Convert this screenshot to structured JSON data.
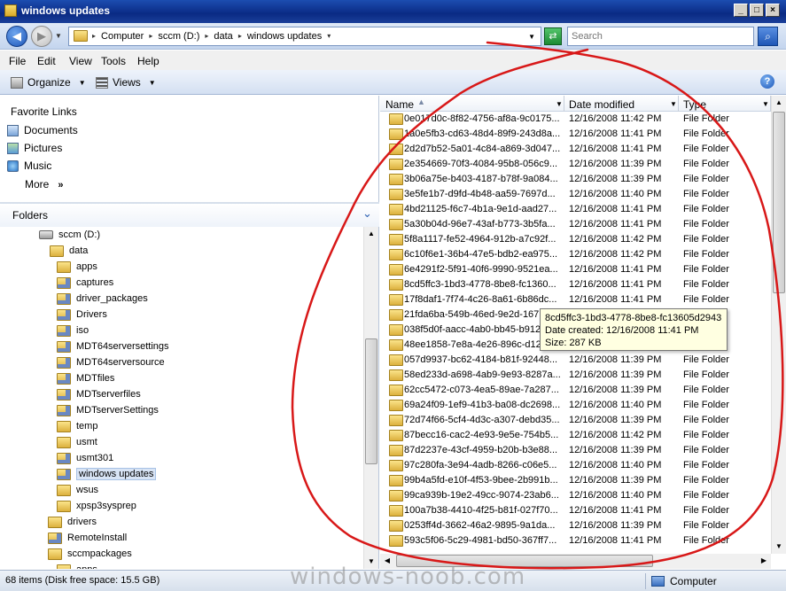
{
  "window": {
    "title": "windows updates"
  },
  "address": {
    "crumbs": [
      "Computer",
      "sccm (D:)",
      "data",
      "windows updates"
    ],
    "search_placeholder": "Search"
  },
  "menu": [
    "File",
    "Edit",
    "View",
    "Tools",
    "Help"
  ],
  "toolbar": {
    "organize": "Organize",
    "views": "Views"
  },
  "favorites": {
    "header": "Favorite Links",
    "items": [
      "Documents",
      "Pictures",
      "Music"
    ],
    "more": "More"
  },
  "folders": {
    "header": "Folders",
    "tree": [
      {
        "label": "sccm (D:)",
        "kind": "drive"
      },
      {
        "label": "data",
        "kind": "folder"
      },
      {
        "label": "apps",
        "kind": "folder"
      },
      {
        "label": "captures",
        "kind": "net"
      },
      {
        "label": "driver_packages",
        "kind": "net"
      },
      {
        "label": "Drivers",
        "kind": "net"
      },
      {
        "label": "iso",
        "kind": "net"
      },
      {
        "label": "MDT64serversettings",
        "kind": "net"
      },
      {
        "label": "MDT64serversource",
        "kind": "net"
      },
      {
        "label": "MDTfiles",
        "kind": "net"
      },
      {
        "label": "MDTserverfiles",
        "kind": "net"
      },
      {
        "label": "MDTserverSettings",
        "kind": "net"
      },
      {
        "label": "temp",
        "kind": "folder"
      },
      {
        "label": "usmt",
        "kind": "folder"
      },
      {
        "label": "usmt301",
        "kind": "net"
      },
      {
        "label": "windows updates",
        "kind": "net",
        "selected": true
      },
      {
        "label": "wsus",
        "kind": "folder"
      },
      {
        "label": "xpsp3sysprep",
        "kind": "folder"
      },
      {
        "label": "drivers",
        "kind": "folder"
      },
      {
        "label": "RemoteInstall",
        "kind": "net"
      },
      {
        "label": "sccmpackages",
        "kind": "folder"
      },
      {
        "label": "apps",
        "kind": "folder"
      }
    ]
  },
  "columns": {
    "name": "Name",
    "date": "Date modified",
    "type": "Type"
  },
  "files": [
    {
      "name": "0e017d0c-8f82-4756-af8a-9c0175...",
      "date": "12/16/2008 11:42 PM",
      "type": "File Folder"
    },
    {
      "name": "1a0e5fb3-cd63-48d4-89f9-243d8a...",
      "date": "12/16/2008 11:41 PM",
      "type": "File Folder"
    },
    {
      "name": "2d2d7b52-5a01-4c84-a869-3d047...",
      "date": "12/16/2008 11:41 PM",
      "type": "File Folder"
    },
    {
      "name": "2e354669-70f3-4084-95b8-056c9...",
      "date": "12/16/2008 11:39 PM",
      "type": "File Folder"
    },
    {
      "name": "3b06a75e-b403-4187-b78f-9a084...",
      "date": "12/16/2008 11:39 PM",
      "type": "File Folder"
    },
    {
      "name": "3e5fe1b7-d9fd-4b48-aa59-7697d...",
      "date": "12/16/2008 11:40 PM",
      "type": "File Folder"
    },
    {
      "name": "4bd21125-f6c7-4b1a-9e1d-aad27...",
      "date": "12/16/2008 11:41 PM",
      "type": "File Folder"
    },
    {
      "name": "5a30b04d-96e7-43af-b773-3b5fa...",
      "date": "12/16/2008 11:41 PM",
      "type": "File Folder"
    },
    {
      "name": "5f8a1117-fe52-4964-912b-a7c92f...",
      "date": "12/16/2008 11:42 PM",
      "type": "File Folder"
    },
    {
      "name": "6c10f6e1-36b4-47e5-bdb2-ea975...",
      "date": "12/16/2008 11:42 PM",
      "type": "File Folder"
    },
    {
      "name": "6e4291f2-5f91-40f6-9990-9521ea...",
      "date": "12/16/2008 11:41 PM",
      "type": "File Folder"
    },
    {
      "name": "8cd5ffc3-1bd3-4778-8be8-fc1360...",
      "date": "12/16/2008 11:41 PM",
      "type": "File Folder"
    },
    {
      "name": "17f8daf1-7f74-4c26-8a61-6b86dc...",
      "date": "12/16/2008 11:41 PM",
      "type": "File Folder"
    },
    {
      "name": "21fda6ba-549b-46ed-9e2d-167",
      "date": "",
      "type": ""
    },
    {
      "name": "038f5d0f-aacc-4ab0-bb45-b912",
      "date": "",
      "type": ""
    },
    {
      "name": "48ee1858-7e8a-4e26-896c-d12",
      "date": "",
      "type": ""
    },
    {
      "name": "057d9937-bc62-4184-b81f-92448...",
      "date": "12/16/2008 11:39 PM",
      "type": "File Folder"
    },
    {
      "name": "58ed233d-a698-4ab9-9e93-8287a...",
      "date": "12/16/2008 11:39 PM",
      "type": "File Folder"
    },
    {
      "name": "62cc5472-c073-4ea5-89ae-7a287...",
      "date": "12/16/2008 11:39 PM",
      "type": "File Folder"
    },
    {
      "name": "69a24f09-1ef9-41b3-ba08-dc2698...",
      "date": "12/16/2008 11:40 PM",
      "type": "File Folder"
    },
    {
      "name": "72d74f66-5cf4-4d3c-a307-debd35...",
      "date": "12/16/2008 11:39 PM",
      "type": "File Folder"
    },
    {
      "name": "87becc16-cac2-4e93-9e5e-754b5...",
      "date": "12/16/2008 11:42 PM",
      "type": "File Folder"
    },
    {
      "name": "87d2237e-43cf-4959-b20b-b3e88...",
      "date": "12/16/2008 11:39 PM",
      "type": "File Folder"
    },
    {
      "name": "97c280fa-3e94-4adb-8266-c06e5...",
      "date": "12/16/2008 11:40 PM",
      "type": "File Folder"
    },
    {
      "name": "99b4a5fd-e10f-4f53-9bee-2b991b...",
      "date": "12/16/2008 11:39 PM",
      "type": "File Folder"
    },
    {
      "name": "99ca939b-19e2-49cc-9074-23ab6...",
      "date": "12/16/2008 11:40 PM",
      "type": "File Folder"
    },
    {
      "name": "100a7b38-4410-4f25-b81f-027f70...",
      "date": "12/16/2008 11:41 PM",
      "type": "File Folder"
    },
    {
      "name": "0253ff4d-3662-46a2-9895-9a1da...",
      "date": "12/16/2008 11:39 PM",
      "type": "File Folder"
    },
    {
      "name": "593c5f06-5c29-4981-bd50-367ff7...",
      "date": "12/16/2008 11:41 PM",
      "type": "File Folder"
    }
  ],
  "tooltip": {
    "name": "8cd5ffc3-1bd3-4778-8be8-fc13605d2943",
    "created": "Date created: 12/16/2008 11:41 PM",
    "size": "Size: 287 KB"
  },
  "status": {
    "items": "68 items (Disk free space: 15.5 GB)",
    "zone": "Computer"
  },
  "watermark": "windows-noob.com",
  "colors": {
    "title_bar": "#0a2a84",
    "annotation": "#d81818",
    "tooltip_bg": "#ffffe1"
  }
}
